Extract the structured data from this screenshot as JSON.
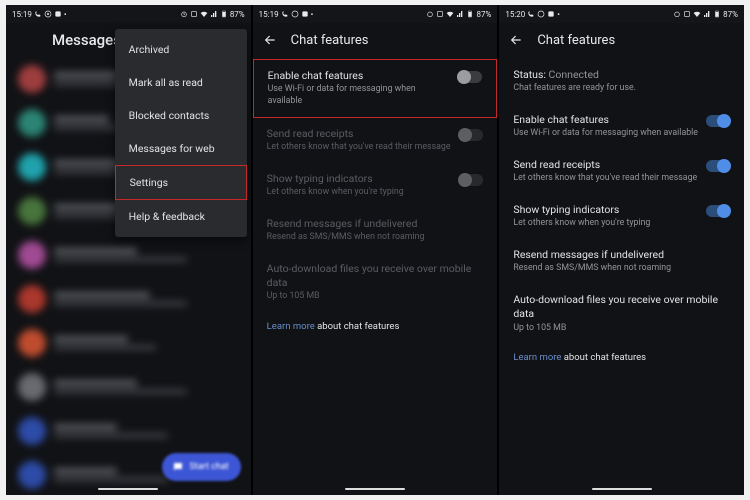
{
  "status": {
    "time_a": "15:19",
    "time_b": "15:19",
    "time_c": "15:20",
    "battery": "87%"
  },
  "phone1": {
    "header": "Messages",
    "menu": {
      "archived": "Archived",
      "mark_all": "Mark all as read",
      "blocked": "Blocked contacts",
      "web": "Messages for web",
      "settings": "Settings",
      "help": "Help & feedback"
    },
    "fab": "Start chat"
  },
  "chat_features": {
    "title": "Chat features",
    "status_label": "Status:",
    "status_value": "Connected",
    "status_sub": "Chat features are ready for use.",
    "enable": {
      "title": "Enable chat features",
      "sub": "Use Wi-Fi or data for messaging when available"
    },
    "receipts": {
      "title": "Send read receipts",
      "sub": "Let others know that you've read their message"
    },
    "typing": {
      "title": "Show typing indicators",
      "sub": "Let others know when you're typing"
    },
    "resend": {
      "title": "Resend messages if undelivered",
      "sub": "Resend as SMS/MMS when not roaming"
    },
    "autodl": {
      "title": "Auto-download files you receive over mobile data",
      "sub": "Up to 105 MB"
    },
    "learn_link": "Learn more",
    "learn_rest": " about chat features"
  }
}
